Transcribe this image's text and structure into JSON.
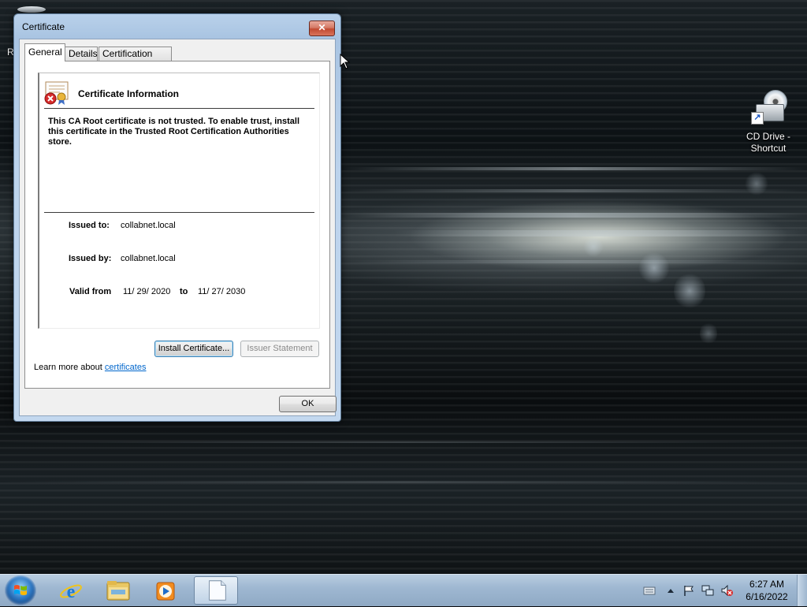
{
  "desktop": {
    "left_partial_label": "R",
    "shortcut_label": "CD Drive - Shortcut"
  },
  "dialog": {
    "title": "Certificate",
    "close_glyph": "✕",
    "tabs": [
      {
        "label": "General",
        "active": true
      },
      {
        "label": "Details",
        "active": false
      },
      {
        "label": "Certification Path",
        "active": false
      }
    ],
    "heading": "Certificate Information",
    "warning": "This CA Root certificate is not trusted. To enable trust, install this certificate in the Trusted Root Certification Authorities store.",
    "issued_to_label": "Issued to:",
    "issued_to_value": "collabnet.local",
    "issued_by_label": "Issued by:",
    "issued_by_value": "collabnet.local",
    "valid_from_label": "Valid from",
    "valid_from_value": "11/ 29/ 2020",
    "valid_to_label": "to",
    "valid_to_value": "11/ 27/ 2030",
    "install_button": "Install Certificate...",
    "issuer_button": "Issuer Statement",
    "learn_more_text": "Learn more about",
    "learn_more_link": "certificates",
    "ok_button": "OK"
  },
  "taskbar": {
    "items": [
      "start-orb",
      "internet-explorer-icon",
      "file-explorer-icon",
      "media-player-icon",
      "notepad-document-icon"
    ],
    "clock_time": "6:27 AM",
    "clock_date": "6/16/2022"
  },
  "colors": {
    "link": "#0066cc",
    "close_button": "#c24a31",
    "window_frame": "#b9d1ea"
  }
}
